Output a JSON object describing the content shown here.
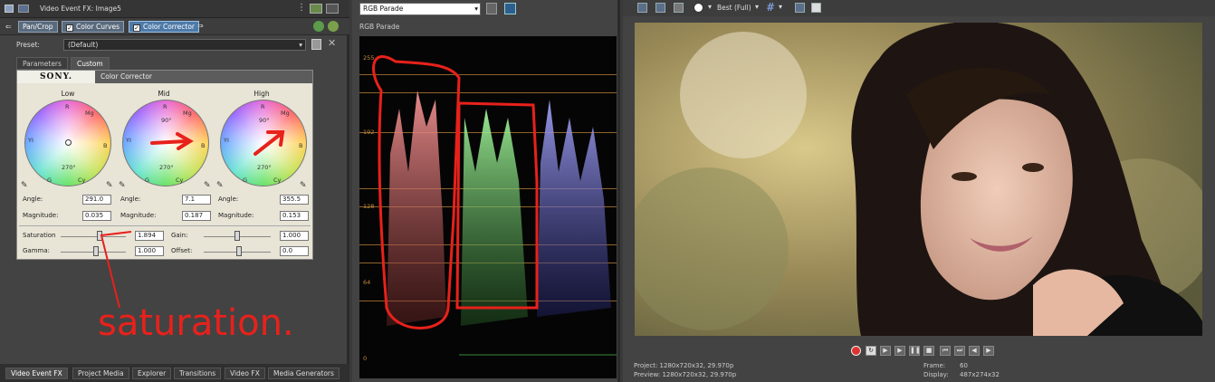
{
  "fx": {
    "title": "Video Event FX: Image5",
    "chain": [
      "Pan/Crop",
      "Color Curves",
      "Color Corrector"
    ],
    "preset_label": "Preset:",
    "preset_value": "(Default)",
    "tabs": [
      "Parameters",
      "Custom"
    ],
    "brand": "SONY.",
    "plugin_title": "Color Corrector",
    "wheels": [
      {
        "label": "Low",
        "angle_label": "Angle:",
        "angle": "291.0",
        "mag_label": "Magnitude:",
        "magnitude": "0.035"
      },
      {
        "label": "Mid",
        "angle_label": "Angle:",
        "angle": "7.1",
        "mag_label": "Magnitude:",
        "magnitude": "0.187"
      },
      {
        "label": "High",
        "angle_label": "Angle:",
        "angle": "355.5",
        "mag_label": "Magnitude:",
        "magnitude": "0.153"
      }
    ],
    "wheel_marks": {
      "top": "R",
      "left": "YI",
      "right": "B",
      "bottom": "Cy",
      "tl": "R",
      "tr": "Mg",
      "deg90": "90°",
      "deg270": "270°",
      "deg180": "180°",
      "bl": "G",
      "br": "Cy"
    },
    "saturation_label": "Saturation",
    "saturation": "1.894",
    "gain_label": "Gain:",
    "gain": "1.000",
    "gamma_label": "Gamma:",
    "gamma": "1.000",
    "offset_label": "Offset:",
    "offset": "0.0",
    "bottom_tabs": [
      "Video Event FX",
      "Project Media",
      "Explorer",
      "Transitions",
      "Video FX",
      "Media Generators"
    ]
  },
  "annotation": {
    "text": "saturation.",
    "color": "#e8211b"
  },
  "scope": {
    "mode": "RGB Parade",
    "label": "RGB Parade",
    "ticks": [
      "255",
      "192",
      "128",
      "64",
      "0"
    ]
  },
  "preview": {
    "quality": "Best (Full)",
    "project": "Project: 1280x720x32, 29.970p",
    "preview": "Preview: 1280x720x32, 29.970p",
    "frame_label": "Frame:",
    "frame": "60",
    "display_label": "Display:",
    "display": "487x274x32"
  },
  "colors": {
    "accent": "#4e7aa8",
    "panel": "#434343",
    "scope_grid": "#b27a35",
    "red_mark": "#e8211b"
  }
}
